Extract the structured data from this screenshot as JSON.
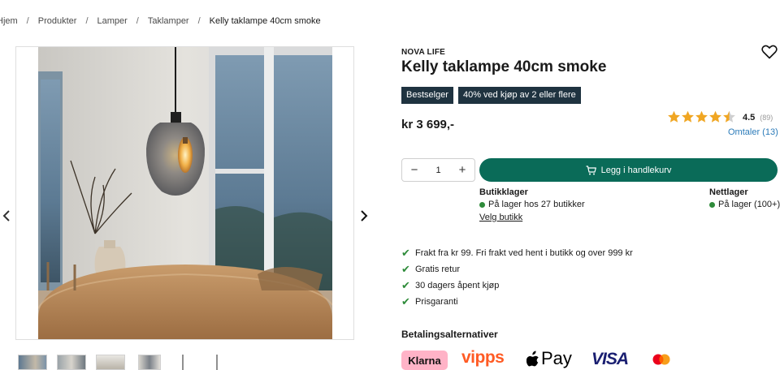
{
  "breadcrumb": {
    "items": [
      "Hjem",
      "Produkter",
      "Lamper",
      "Taklamper"
    ],
    "current": "Kelly taklampe 40cm smoke",
    "separator": "/"
  },
  "product": {
    "brand": "NOVA LIFE",
    "title": "Kelly taklampe 40cm smoke",
    "badges": [
      "Bestselger",
      "40% ved kjøp av 2 eller flere"
    ],
    "price": "kr 3 699,-",
    "rating": {
      "value": "4.5",
      "count": "(89)",
      "stars_filled": 4.5,
      "stars_total": 5
    },
    "reviews_link": "Omtaler (13)"
  },
  "purchase": {
    "quantity": "1",
    "minus": "−",
    "plus": "+",
    "cart_label": "Legg i handlekurv"
  },
  "stock": {
    "store": {
      "heading": "Butikklager",
      "status": "På lager hos 27 butikker",
      "link": "Velg butikk"
    },
    "web": {
      "heading": "Nettlager",
      "status": "På lager (100+)"
    }
  },
  "usps": [
    "Frakt fra kr 99. Fri frakt ved hent i butikk og over 999 kr",
    "Gratis retur",
    "30 dagers åpent kjøp",
    "Prisgaranti"
  ],
  "payments": {
    "heading": "Betalingsalternativer",
    "methods": [
      "Klarna",
      "vipps",
      "Pay",
      "VISA"
    ]
  },
  "colors": {
    "accent": "#0a6b58",
    "badge": "#1f3340",
    "star": "#f0a623",
    "link": "#2b7bb9",
    "stock": "#2e8b3a"
  },
  "gallery": {
    "thumbnail_count": 6
  }
}
